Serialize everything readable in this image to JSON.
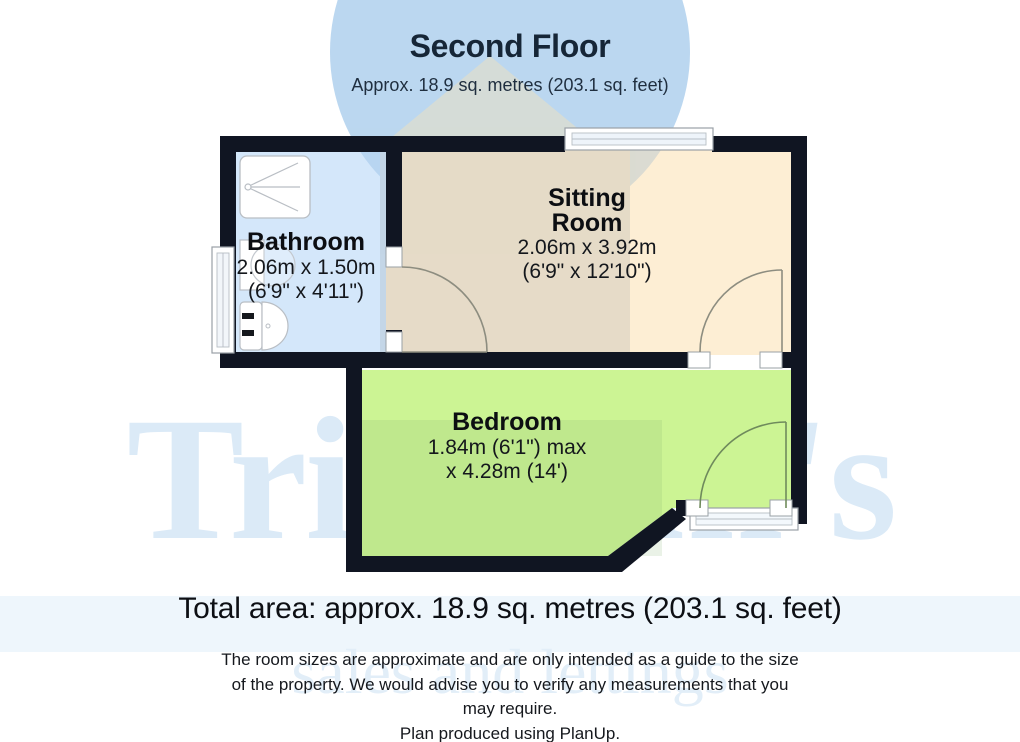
{
  "header": {
    "title": "Second Floor",
    "subtitle": "Approx. 18.9 sq. metres (203.1 sq. feet)"
  },
  "watermark": {
    "brand": "Tristram's",
    "tagline": "sales and lettings"
  },
  "rooms": [
    {
      "id": "bathroom",
      "name": "Bathroom",
      "dim_metric": "2.06m x 1.50m",
      "dim_imperial": "(6'9\" x 4'11\")",
      "color": "#d4e7fa",
      "fixtures": [
        "shower-tray",
        "toilet",
        "wash-basin"
      ]
    },
    {
      "id": "sitting-room",
      "name_line1": "Sitting",
      "name_line2": "Room",
      "dim_metric": "2.06m x 3.92m",
      "dim_imperial": "(6'9\" x 12'10\")",
      "color": "#fdeed4"
    },
    {
      "id": "bedroom",
      "name": "Bedroom",
      "dim_metric": "1.84m (6'1\") max",
      "dim_imperial": "x 4.28m (14')",
      "color": "#ccf494"
    }
  ],
  "footer": {
    "total_area": "Total area: approx. 18.9 sq. metres (203.1 sq. feet)",
    "disclaimer_line1": "The room sizes are approximate and are only intended as a guide to the size",
    "disclaimer_line2": "of the property. We would advise you to verify any measurements that you",
    "disclaimer_line3": "may require.",
    "disclaimer_line4": "Plan produced using PlanUp."
  },
  "colors": {
    "wall": "#101522",
    "bathroom_fill": "#d4e7fa",
    "sitting_fill": "#fdeed4",
    "bedroom_fill": "#ccf494",
    "window_frame": "#9aa0a6",
    "door_arc": "#8b8b80",
    "watermark_blue": "#d7e9f8"
  }
}
